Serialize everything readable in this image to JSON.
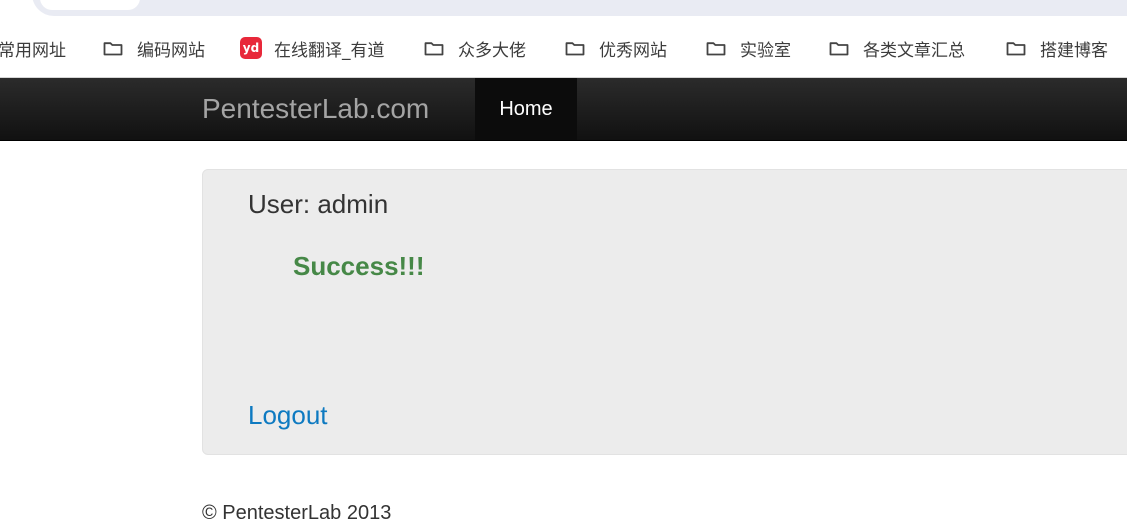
{
  "bookmarks": {
    "items": [
      {
        "label": "常用网址",
        "icon": "none"
      },
      {
        "label": "编码网站",
        "icon": "folder-icon"
      },
      {
        "label": "在线翻译_有道",
        "icon": "youdao-icon",
        "badge": "yd"
      },
      {
        "label": "众多大佬",
        "icon": "folder-icon"
      },
      {
        "label": "优秀网站",
        "icon": "folder-icon"
      },
      {
        "label": "实验室",
        "icon": "folder-icon"
      },
      {
        "label": "各类文章汇总",
        "icon": "folder-icon"
      },
      {
        "label": "搭建博客",
        "icon": "folder-icon"
      }
    ]
  },
  "navbar": {
    "brand": "PentesterLab.com",
    "home": "Home"
  },
  "main": {
    "user_line": "User: admin",
    "message": "Success!!!",
    "logout": "Logout"
  },
  "footer": {
    "text": "© PentesterLab 2013"
  },
  "colors": {
    "navbar": "#111111",
    "success": "#468847",
    "link": "#0e7ac1",
    "well": "#ececec",
    "youdao": "#e8283a"
  }
}
